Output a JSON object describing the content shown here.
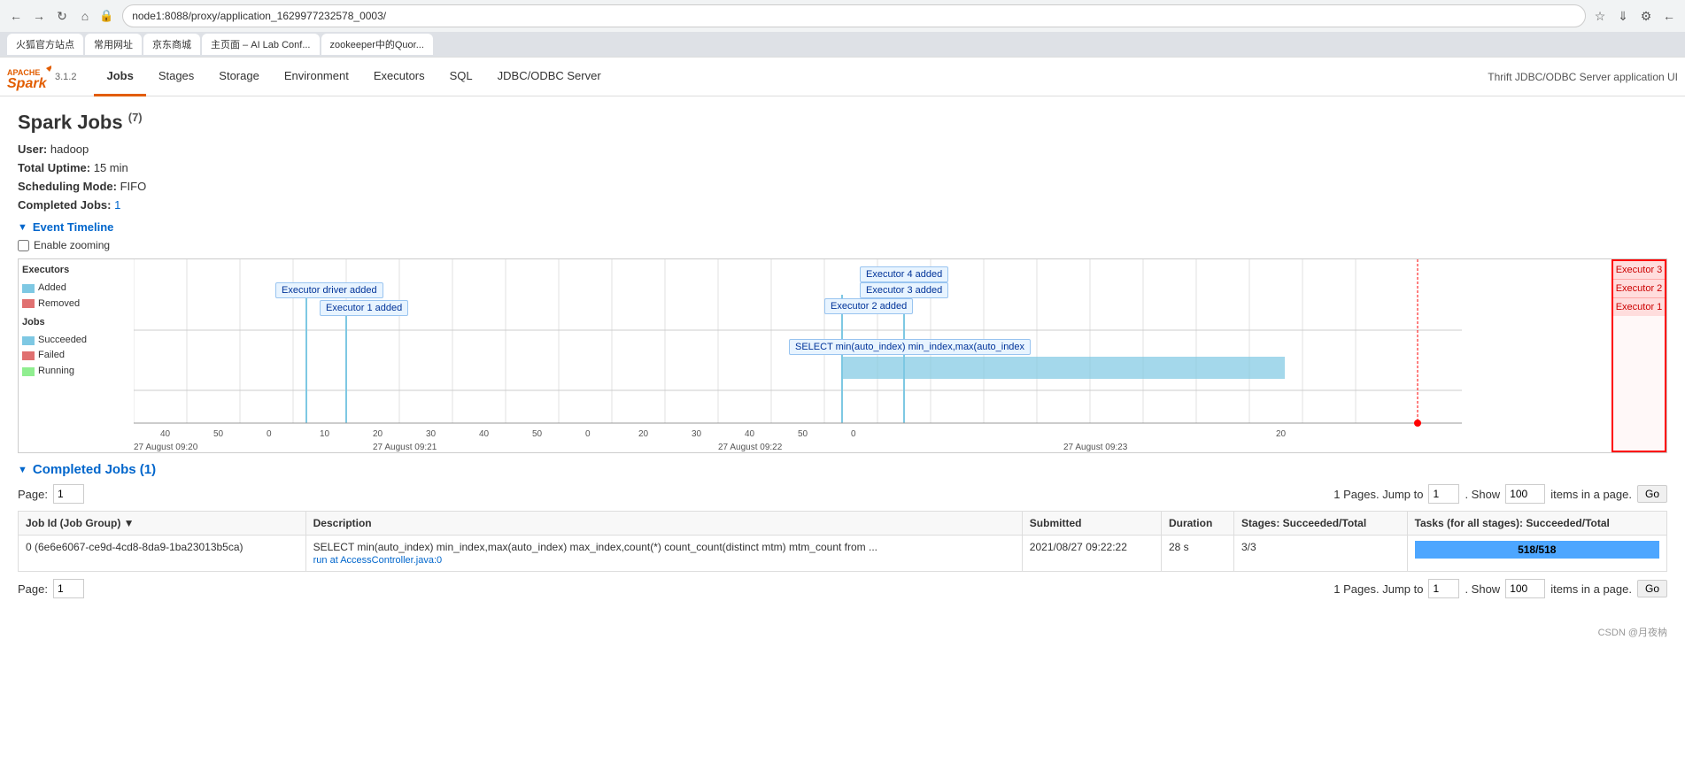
{
  "browser": {
    "address": "node1:8088/proxy/application_1629977232578_0003/",
    "tabs": [
      {
        "label": "火狐官方站点"
      },
      {
        "label": "常用网址"
      },
      {
        "label": "京东商城"
      },
      {
        "label": "主页面 – AI Lab Conf..."
      },
      {
        "label": "zookeeper中的Quor..."
      }
    ]
  },
  "nav": {
    "version": "3.1.2",
    "links": [
      "Jobs",
      "Stages",
      "Storage",
      "Environment",
      "Executors",
      "SQL",
      "JDBC/ODBC Server"
    ],
    "active": "Jobs",
    "right_text": "Thrift JDBC/ODBC Server application UI"
  },
  "page": {
    "title": "Spark Jobs",
    "job_count": "(7)",
    "user_label": "User:",
    "user_value": "hadoop",
    "uptime_label": "Total Uptime:",
    "uptime_value": "15 min",
    "scheduling_label": "Scheduling Mode:",
    "scheduling_value": "FIFO",
    "completed_label": "Completed Jobs:",
    "completed_value": "1"
  },
  "timeline": {
    "title": "Event Timeline",
    "enable_zooming": "Enable zooming",
    "legend": {
      "executors": "Executors",
      "added": "Added",
      "removed": "Removed",
      "jobs": "Jobs",
      "succeeded": "Succeeded",
      "failed": "Failed",
      "running": "Running"
    },
    "tooltips": [
      {
        "text": "Executor driver added",
        "left": "17%",
        "top": "18%"
      },
      {
        "text": "Executor 1 added",
        "left": "20%",
        "top": "28%"
      },
      {
        "text": "Executor 4 added",
        "left": "72%",
        "top": "10%"
      },
      {
        "text": "Executor 3 added",
        "left": "72%",
        "top": "19%"
      },
      {
        "text": "Executor 2 added",
        "left": "68%",
        "top": "30%"
      },
      {
        "text": "SELECT min(auto_index) min_index,max(auto_index",
        "left": "64%",
        "top": "55%"
      }
    ],
    "axis_labels": [
      {
        "text": "40",
        "pos": "5%"
      },
      {
        "text": "50",
        "pos": "11%"
      },
      {
        "text": "0",
        "pos": "17%"
      },
      {
        "text": "10",
        "pos": "23%"
      },
      {
        "text": "20",
        "pos": "29%"
      },
      {
        "text": "30",
        "pos": "35%"
      },
      {
        "text": "40",
        "pos": "41%"
      },
      {
        "text": "50",
        "pos": "47%"
      },
      {
        "text": "0",
        "pos": "53%"
      },
      {
        "text": "20",
        "pos": "59%"
      },
      {
        "text": "30",
        "pos": "65%"
      },
      {
        "text": "40",
        "pos": "71%"
      },
      {
        "text": "50",
        "pos": "77%"
      },
      {
        "text": "0",
        "pos": "83%"
      },
      {
        "text": "20",
        "pos": "96%"
      }
    ],
    "time_labels": [
      {
        "text": "27 August 09:20",
        "pos": "8%"
      },
      {
        "text": "27 August 09:21",
        "pos": "25%"
      },
      {
        "text": "27 August 09:22",
        "pos": "55%"
      },
      {
        "text": "27 August 09:23",
        "pos": "83%"
      }
    ],
    "right_labels": [
      {
        "text": "Executor 3"
      },
      {
        "text": "Executor 2"
      },
      {
        "text": "Executor 1"
      }
    ]
  },
  "completed_jobs": {
    "title": "Completed Jobs (1)",
    "pagination": {
      "page_label": "Page:",
      "page_value": "1",
      "pages_info": "1 Pages. Jump to",
      "jump_value": "1",
      "show_label": ". Show",
      "show_value": "100",
      "items_label": "items in a page.",
      "go_label": "Go"
    },
    "table": {
      "headers": [
        "Job Id (Job Group) ▼",
        "Description",
        "Submitted",
        "Duration",
        "Stages: Succeeded/Total",
        "Tasks (for all stages): Succeeded/Total"
      ],
      "rows": [
        {
          "job_id": "0 (6e6e6067-ce9d-4cd8-8da9-1ba23013b5ca)",
          "description": "SELECT min(auto_index) min_index,max(auto_index) max_index,count(*) count_count(distinct mtm) mtm_count from ...",
          "run_at": "run at AccessController.java:0",
          "submitted": "2021/08/27 09:22:22",
          "duration": "28 s",
          "stages": "3/3",
          "tasks": "518/518",
          "tasks_pct": 100
        }
      ]
    }
  },
  "footer": {
    "credit": "CSDN @月夜枘"
  }
}
